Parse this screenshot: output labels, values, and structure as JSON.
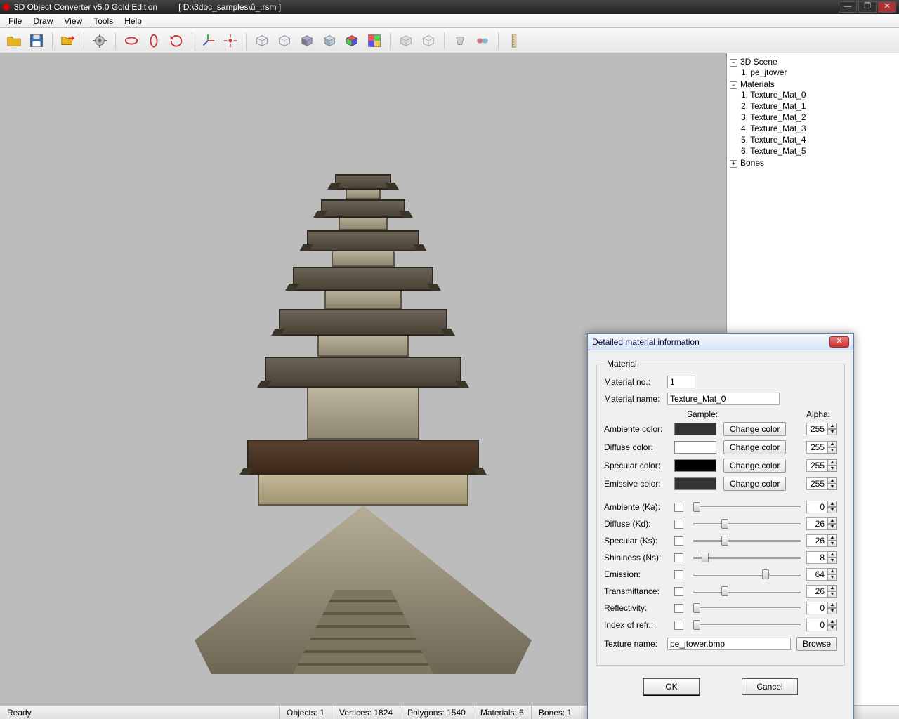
{
  "title": {
    "app": "3D Object Converter v5.0 Gold Edition",
    "path": "[ D:\\3doc_samples\\ů_.rsm ]"
  },
  "menu": [
    "File",
    "Draw",
    "View",
    "Tools",
    "Help"
  ],
  "tree": {
    "scene_label": "3D Scene",
    "scene_items": [
      "1.   pe_jtower"
    ],
    "materials_label": "Materials",
    "materials": [
      "1.   Texture_Mat_0",
      "2.   Texture_Mat_1",
      "3.   Texture_Mat_2",
      "4.   Texture_Mat_3",
      "5.   Texture_Mat_4",
      "6.   Texture_Mat_5"
    ],
    "bones_label": "Bones"
  },
  "status": {
    "ready": "Ready",
    "objects": "Objects: 1",
    "vertices": "Vertices: 1824",
    "polygons": "Polygons: 1540",
    "materials": "Materials: 6",
    "bones": "Bones: 1"
  },
  "dialog": {
    "title": "Detailed material information",
    "legend": "Material",
    "labels": {
      "matno": "Material no.:",
      "matname": "Material name:",
      "sample": "Sample:",
      "alpha": "Alpha:",
      "amb": "Ambiente color:",
      "dif": "Diffuse color:",
      "spec": "Specular color:",
      "emi": "Emissive color:",
      "change": "Change color",
      "ka": "Ambiente (Ka):",
      "kd": "Diffuse (Kd):",
      "ks": "Specular (Ks):",
      "ns": "Shininess (Ns):",
      "emission": "Emission:",
      "trans": "Transmittance:",
      "refl": "Reflectivity:",
      "ior": "Index of refr.:",
      "texname": "Texture name:",
      "browse": "Browse",
      "ok": "OK",
      "cancel": "Cancel"
    },
    "values": {
      "matno": "1",
      "matname": "Texture_Mat_0",
      "amb_color": "#333333",
      "dif_color": "#ffffff",
      "spec_color": "#000000",
      "emi_color": "#333333",
      "amb_alpha": "255",
      "dif_alpha": "255",
      "spec_alpha": "255",
      "emi_alpha": "255",
      "ka": "0",
      "kd": "26",
      "ks": "26",
      "ns": "8",
      "emission": "64",
      "trans": "26",
      "refl": "0",
      "ior": "0",
      "texture": "pe_jtower.bmp"
    }
  }
}
